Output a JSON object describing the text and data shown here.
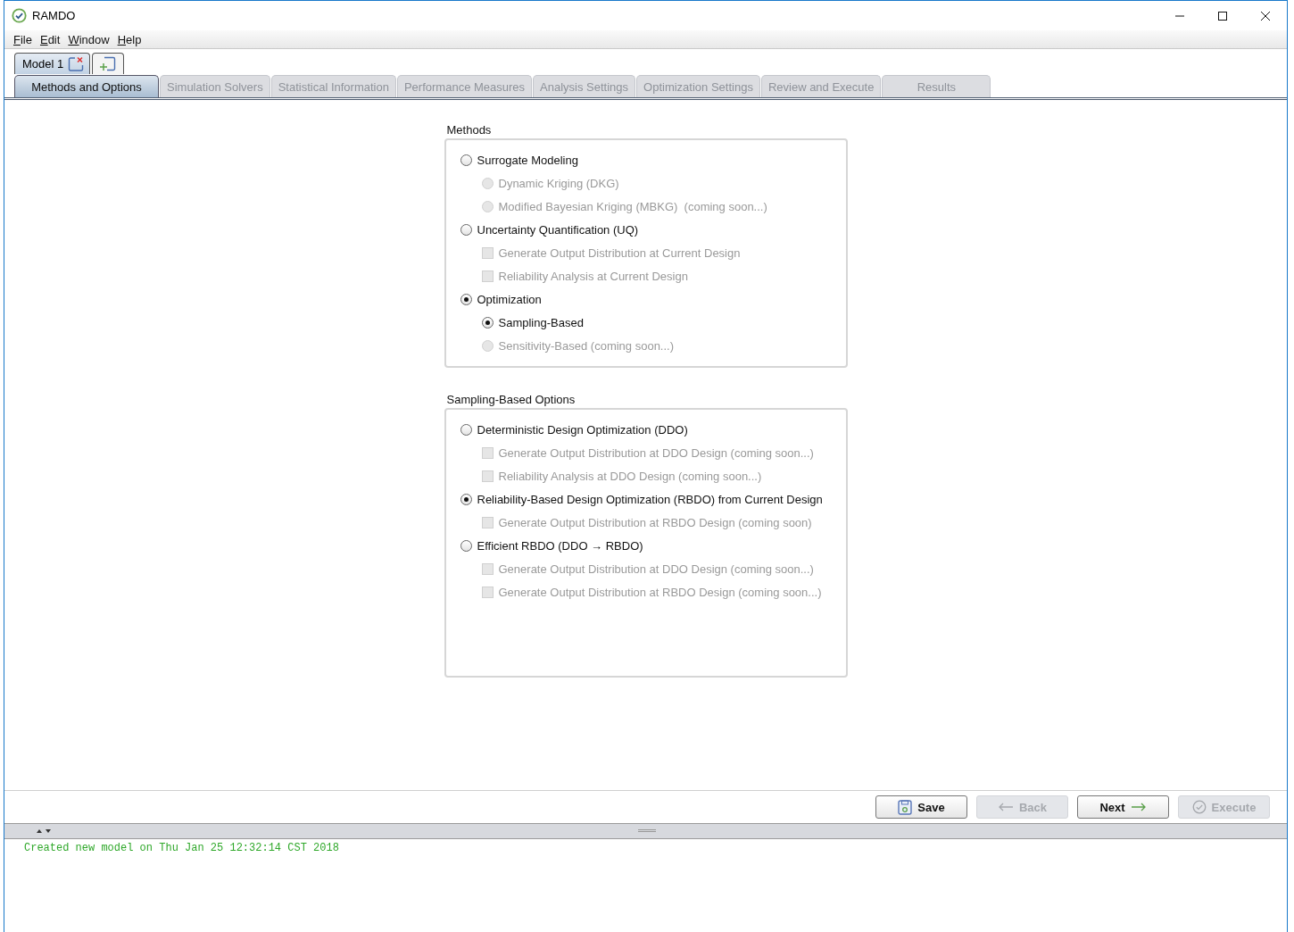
{
  "window": {
    "title": "RAMDO"
  },
  "menu": [
    "File",
    "Edit",
    "Window",
    "Help"
  ],
  "model_tabs": [
    {
      "label": "Model 1",
      "selected": true
    }
  ],
  "tabs": [
    {
      "label": "Methods and Options",
      "selected": true
    },
    {
      "label": "Simulation Solvers",
      "selected": false
    },
    {
      "label": "Statistical Information",
      "selected": false
    },
    {
      "label": "Performance Measures",
      "selected": false
    },
    {
      "label": "Analysis Settings",
      "selected": false
    },
    {
      "label": "Optimization Settings",
      "selected": false
    },
    {
      "label": "Review and Execute",
      "selected": false
    },
    {
      "label": "Results",
      "selected": false
    }
  ],
  "groups": [
    {
      "title": "Methods",
      "options": [
        {
          "kind": "radio",
          "label": "Surrogate Modeling",
          "checked": false,
          "disabled": false,
          "children": [
            {
              "kind": "radio",
              "label": "Dynamic Kriging (DKG)",
              "checked": false,
              "disabled": true
            },
            {
              "kind": "radio",
              "label": "Modified Bayesian Kriging (MBKG)  (coming soon...)",
              "checked": false,
              "disabled": true
            }
          ]
        },
        {
          "kind": "radio",
          "label": "Uncertainty Quantification (UQ)",
          "checked": false,
          "disabled": false,
          "children": [
            {
              "kind": "checkbox",
              "label": "Generate Output Distribution at Current Design",
              "checked": false,
              "disabled": true
            },
            {
              "kind": "checkbox",
              "label": "Reliability Analysis at Current Design",
              "checked": false,
              "disabled": true
            }
          ]
        },
        {
          "kind": "radio",
          "label": "Optimization",
          "checked": true,
          "disabled": false,
          "children": [
            {
              "kind": "radio",
              "label": "Sampling-Based",
              "checked": true,
              "disabled": false
            },
            {
              "kind": "radio",
              "label": "Sensitivity-Based (coming soon...)",
              "checked": false,
              "disabled": true
            }
          ]
        }
      ]
    },
    {
      "title": "Sampling-Based Options",
      "options": [
        {
          "kind": "radio",
          "label": "Deterministic Design Optimization (DDO)",
          "checked": false,
          "disabled": false,
          "children": [
            {
              "kind": "checkbox",
              "label": "Generate Output Distribution at DDO Design (coming soon...)",
              "checked": false,
              "disabled": true
            },
            {
              "kind": "checkbox",
              "label": "Reliability Analysis at DDO Design (coming soon...)",
              "checked": false,
              "disabled": true
            }
          ]
        },
        {
          "kind": "radio",
          "label": "Reliability-Based Design Optimization (RBDO) from Current Design",
          "checked": true,
          "disabled": false,
          "children": [
            {
              "kind": "checkbox",
              "label": "Generate Output Distribution at RBDO Design (coming soon)",
              "checked": false,
              "disabled": true
            }
          ]
        },
        {
          "kind": "radio",
          "label": "Efficient RBDO (DDO → RBDO)",
          "checked": false,
          "disabled": false,
          "children": [
            {
              "kind": "checkbox",
              "label": "Generate Output Distribution at DDO Design (coming soon...)",
              "checked": false,
              "disabled": true
            },
            {
              "kind": "checkbox",
              "label": "Generate Output Distribution at RBDO Design (coming soon...)",
              "checked": false,
              "disabled": true
            }
          ]
        }
      ]
    }
  ],
  "buttons": [
    {
      "kind": "save",
      "label": "Save",
      "disabled": false
    },
    {
      "kind": "back",
      "label": "Back",
      "disabled": true
    },
    {
      "kind": "next",
      "label": "Next",
      "disabled": false
    },
    {
      "kind": "execute",
      "label": "Execute",
      "disabled": true
    }
  ],
  "log": [
    "Created new model on Thu Jan 25 12:32:14 CST 2018"
  ]
}
